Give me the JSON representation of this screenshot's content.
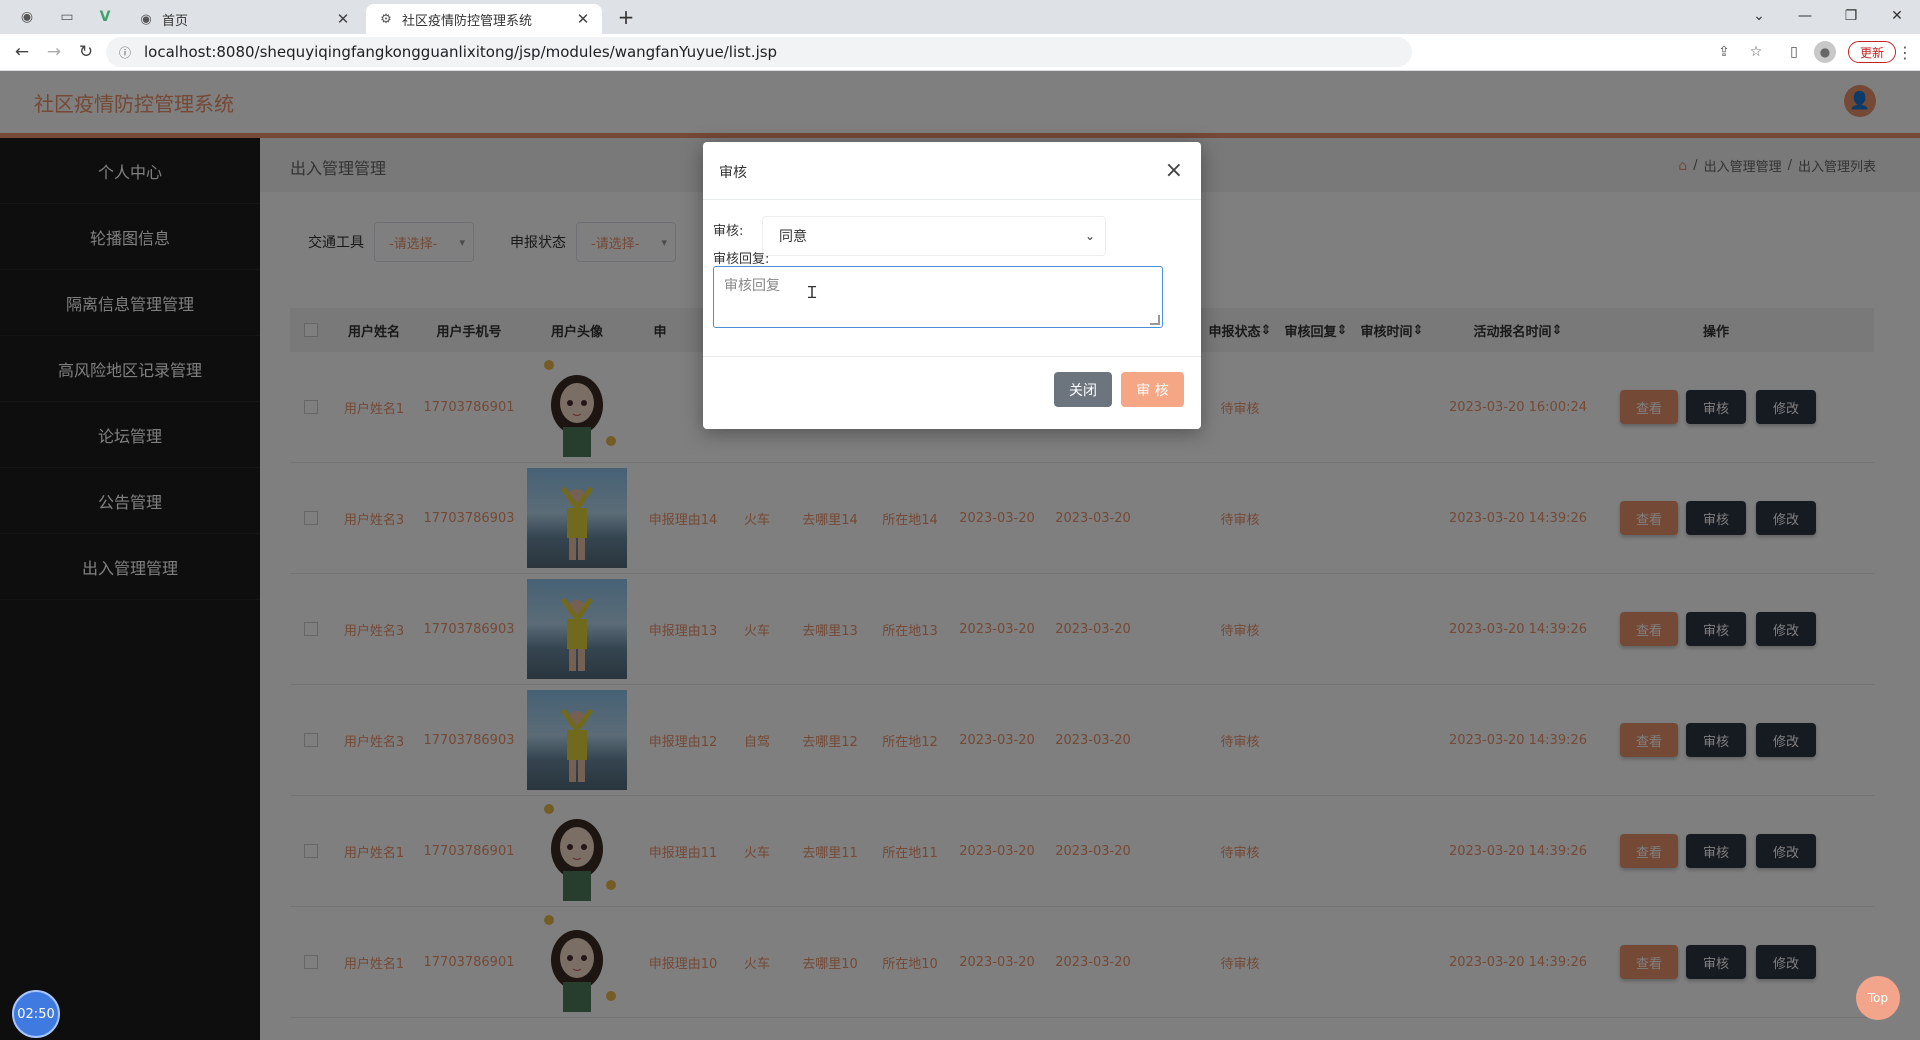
{
  "browser": {
    "tabs": [
      {
        "title": "首页",
        "active": false,
        "icon": "globe-icon"
      },
      {
        "title": "社区疫情防控管理系统",
        "active": true,
        "icon": "gear-icon"
      }
    ],
    "url": "localhost:8080/shequyiqingfangkongguanlixitong/jsp/modules/wangfanYuyue/list.jsp",
    "update_label": "更新"
  },
  "app": {
    "title": "社区疫情防控管理系统",
    "accent": "#e8936d"
  },
  "sidebar": {
    "items": [
      {
        "label": "个人中心"
      },
      {
        "label": "轮播图信息"
      },
      {
        "label": "隔离信息管理管理"
      },
      {
        "label": "高风险地区记录管理"
      },
      {
        "label": "论坛管理"
      },
      {
        "label": "公告管理"
      },
      {
        "label": "出入管理管理"
      }
    ]
  },
  "main": {
    "heading": "出入管理管理",
    "breadcrumb": [
      "出入管理管理",
      "出入管理列表"
    ],
    "breadcrumb_sep": "/"
  },
  "search": {
    "fields": [
      {
        "label": "交通工具",
        "placeholder": "-请选择-"
      },
      {
        "label": "申报状态",
        "placeholder": "-请选择-"
      }
    ]
  },
  "table": {
    "headers": {
      "name": "用户姓名",
      "phone": "用户手机号",
      "avatar": "用户头像",
      "reason": "申",
      "status": "申报状态",
      "reply": "审核回复",
      "audit_time": "审核时间",
      "signup_time": "活动报名时间",
      "ops": "操作"
    },
    "sort_icon": "⇕",
    "row_labels": {
      "view": "查看",
      "audit": "审核",
      "edit": "修改"
    },
    "rows": [
      {
        "name": "用户姓名1",
        "phone": "17703786901",
        "avatar": "anime",
        "reason": "",
        "vehicle": "",
        "dest": "",
        "loc": "",
        "date1": "",
        "date2": "",
        "status": "待审核",
        "signup": "2023-03-20 16:00:24"
      },
      {
        "name": "用户姓名3",
        "phone": "17703786903",
        "avatar": "photo",
        "reason": "申报理由14",
        "vehicle": "火车",
        "dest": "去哪里14",
        "loc": "所在地14",
        "date1": "2023-03-20",
        "date2": "2023-03-20",
        "status": "待审核",
        "signup": "2023-03-20 14:39:26"
      },
      {
        "name": "用户姓名3",
        "phone": "17703786903",
        "avatar": "photo",
        "reason": "申报理由13",
        "vehicle": "火车",
        "dest": "去哪里13",
        "loc": "所在地13",
        "date1": "2023-03-20",
        "date2": "2023-03-20",
        "status": "待审核",
        "signup": "2023-03-20 14:39:26"
      },
      {
        "name": "用户姓名3",
        "phone": "17703786903",
        "avatar": "photo",
        "reason": "申报理由12",
        "vehicle": "自驾",
        "dest": "去哪里12",
        "loc": "所在地12",
        "date1": "2023-03-20",
        "date2": "2023-03-20",
        "status": "待审核",
        "signup": "2023-03-20 14:39:26"
      },
      {
        "name": "用户姓名1",
        "phone": "17703786901",
        "avatar": "anime",
        "reason": "申报理由11",
        "vehicle": "火车",
        "dest": "去哪里11",
        "loc": "所在地11",
        "date1": "2023-03-20",
        "date2": "2023-03-20",
        "status": "待审核",
        "signup": "2023-03-20 14:39:26"
      },
      {
        "name": "用户姓名1",
        "phone": "17703786901",
        "avatar": "anime",
        "reason": "申报理由10",
        "vehicle": "火车",
        "dest": "去哪里10",
        "loc": "所在地10",
        "date1": "2023-03-20",
        "date2": "2023-03-20",
        "status": "待审核",
        "signup": "2023-03-20 14:39:26"
      }
    ]
  },
  "modal": {
    "title": "审核",
    "audit_label": "审核:",
    "audit_value": "同意",
    "reply_label": "审核回复:",
    "reply_placeholder": "审核回复",
    "close_label": "关闭",
    "submit_label": "审 核"
  },
  "widgets": {
    "timer": "02:50",
    "top": "Top"
  }
}
